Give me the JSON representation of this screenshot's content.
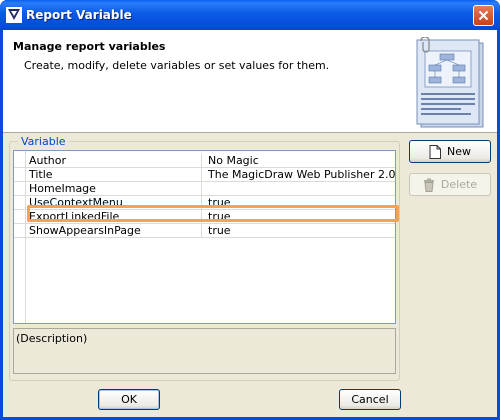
{
  "window": {
    "title": "Report Variable"
  },
  "header": {
    "title": "Manage report variables",
    "subtitle": "Create, modify, delete variables or set values for them."
  },
  "variables": {
    "group_label": "Variable",
    "rows": [
      {
        "name": "Author",
        "value": "No Magic"
      },
      {
        "name": "Title",
        "value": "The MagicDraw Web Publisher 2.0"
      },
      {
        "name": "HomeImage",
        "value": ""
      },
      {
        "name": "UseContextMenu",
        "value": "true"
      },
      {
        "name": "ExportLinkedFile",
        "value": "true"
      },
      {
        "name": "ShowAppearsInPage",
        "value": "true"
      }
    ],
    "description_placeholder": "(Description)"
  },
  "side_buttons": {
    "new_label": "New",
    "delete_label": "Delete"
  },
  "footer": {
    "ok_label": "OK",
    "cancel_label": "Cancel"
  },
  "colors": {
    "titlebar": "#0b5ae6",
    "highlight": "#f5a352",
    "group_legend": "#0046d5",
    "dialog_bg": "#ece9d8"
  },
  "icons": {
    "app": "app-icon",
    "close": "close-icon",
    "header": "document-diagram-icon",
    "new": "new-document-icon",
    "delete": "trash-icon"
  }
}
